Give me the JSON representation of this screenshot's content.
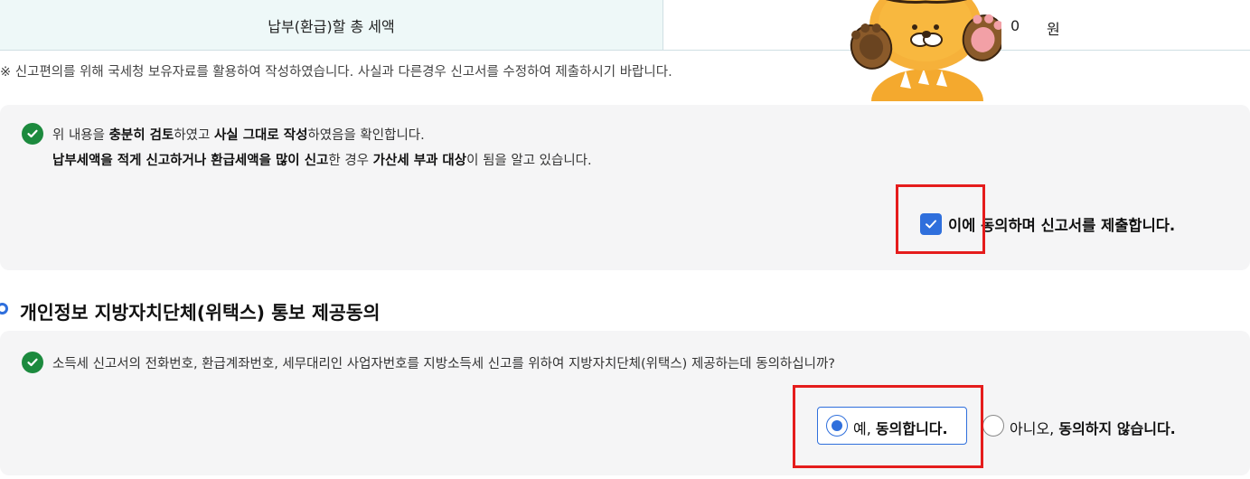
{
  "total": {
    "label": "납부(환급)할 총 세액",
    "amount": "0",
    "unit": "원"
  },
  "notice": "※ 신고편의를 위해 국세청 보유자료를 활용하여 작성하였습니다. 사실과 다른경우 신고서를 수정하여 제출하시기 바랍니다.",
  "confirm": {
    "line1": [
      "위 내용을 ",
      "충분히 검토",
      "하였고 ",
      "사실 그대로 작성",
      "하였음을 확인합니다."
    ],
    "line2": [
      "납부세액을 적게 신고하거나 환급세액을 많이 신고",
      "한 경우 ",
      "가산세 부과 대상",
      "이 됨을 알고 있습니다."
    ],
    "agree_label": "이에 동의하며 신고서를 제출합니다.",
    "agree_checked": true
  },
  "privacy": {
    "title": "개인정보 지방자치단체(위택스) 통보 제공동의",
    "question": "소득세 신고서의 전화번호, 환급계좌번호, 세무대리인 사업자번호를 지방소득세 신고를 위하여 지방자치단체(위택스) 제공하는데 동의하십니까?",
    "yes_prefix": "예, ",
    "yes_bold": "동의합니다.",
    "no_prefix": "아니오, ",
    "no_bold": "동의하지 않습니다.",
    "selected": "yes"
  },
  "colors": {
    "accent": "#2f6fdc",
    "success": "#1c8a3e",
    "highlight": "#e51c1c",
    "panel": "#f5f5f6",
    "header_cell": "#eef8f8"
  },
  "icons": {
    "check": "check-circle-icon",
    "checkbox": "checkbox-checked-icon",
    "mascot": "mascot-lion-icon"
  }
}
